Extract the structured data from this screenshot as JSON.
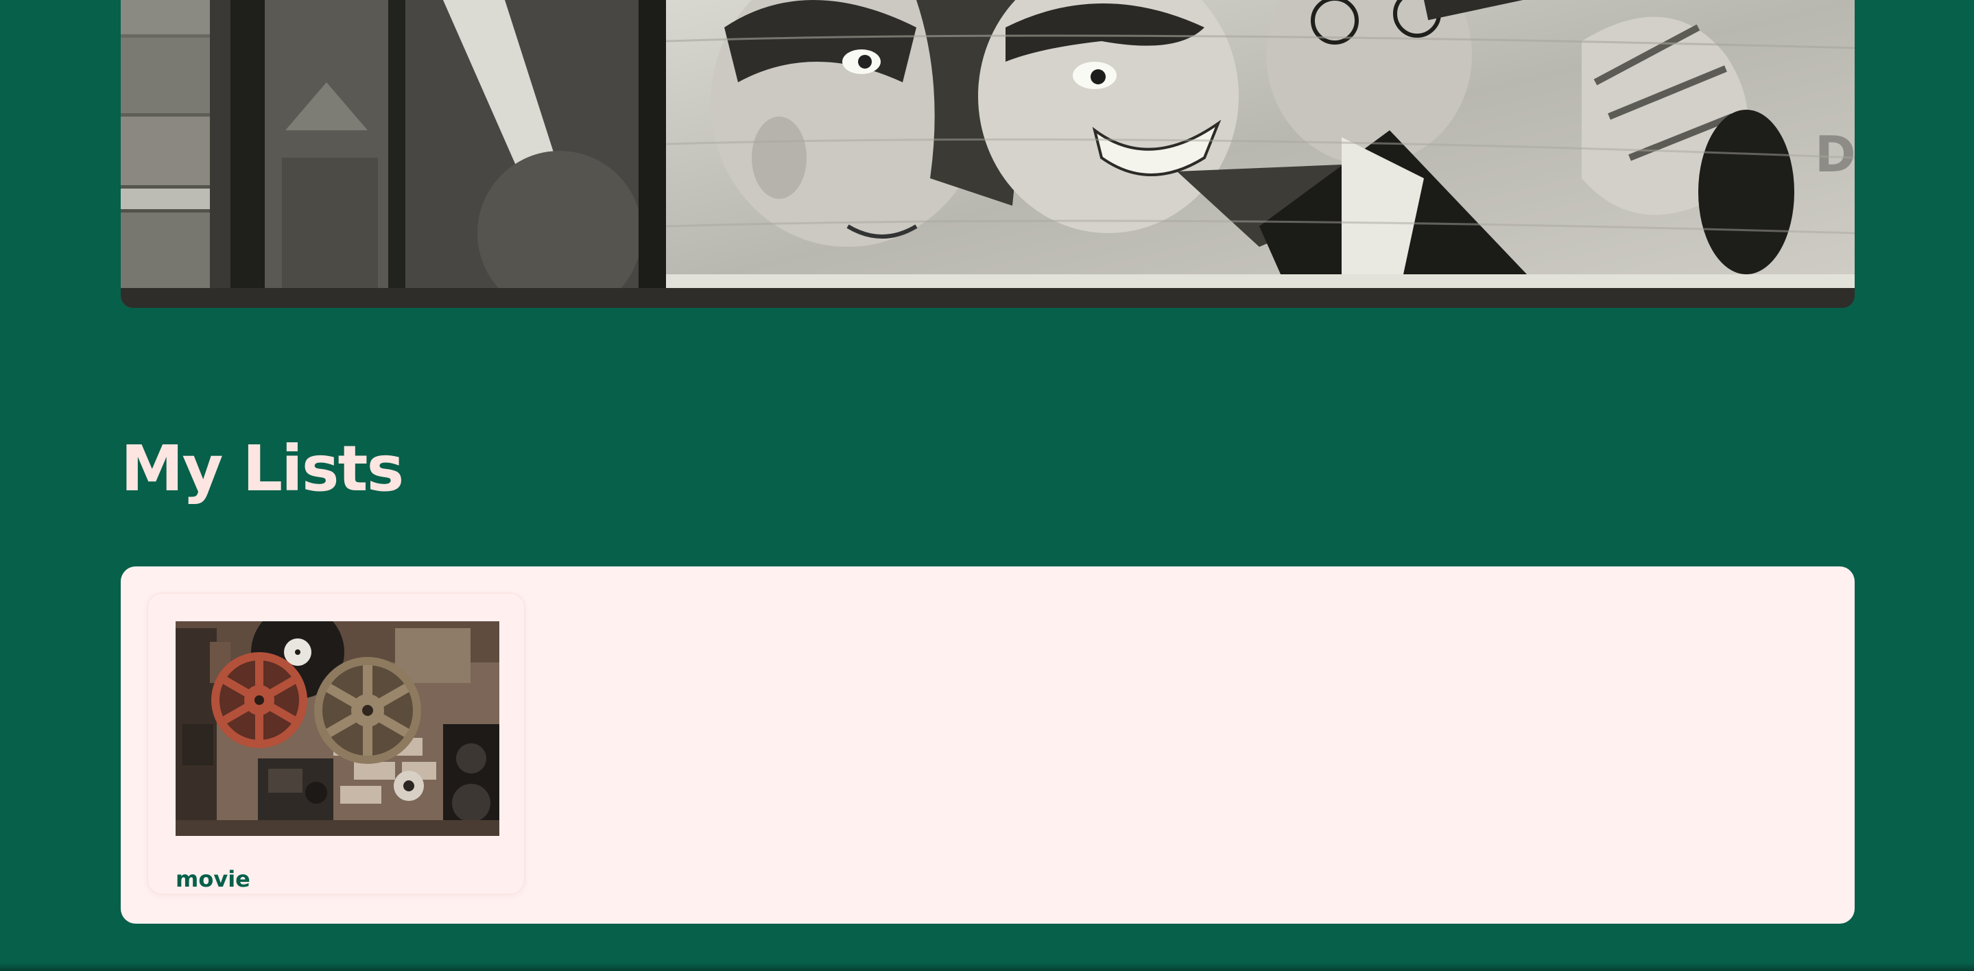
{
  "hero": {
    "image": "vintage-poster-image",
    "poster_text": "DO"
  },
  "lists_section": {
    "title": "My Lists",
    "items": [
      {
        "title": "movie",
        "image": "film-reels-projector-image"
      }
    ]
  },
  "colors": {
    "background": "#07604a",
    "panel": "#fff1f0",
    "heading": "#fde6e1",
    "card_title": "#07604a"
  }
}
